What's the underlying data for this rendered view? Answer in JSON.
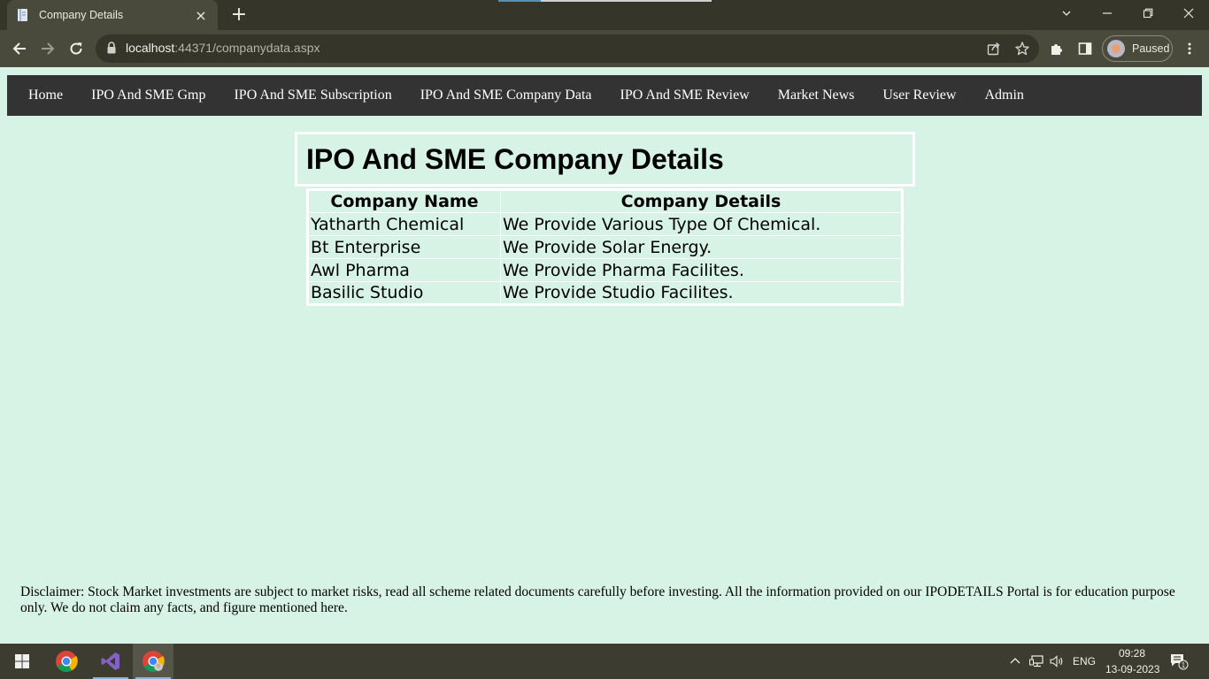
{
  "browser": {
    "tab_title": "Company Details",
    "tab_close_icon": "×",
    "new_tab_icon": "+",
    "url_host": "localhost",
    "url_rest": ":44371/companydata.aspx",
    "profile_label": "Paused"
  },
  "nav": {
    "items": [
      "Home",
      "IPO And SME Gmp",
      "IPO And SME Subscription",
      "IPO And SME Company Data",
      "IPO And SME Review",
      "Market News",
      "User Review",
      "Admin"
    ]
  },
  "page": {
    "title": "IPO And SME Company Details",
    "table": {
      "headers": [
        "Company Name",
        "Company Details"
      ],
      "rows": [
        [
          "Yatharth Chemical",
          "We Provide Various Type Of Chemical."
        ],
        [
          "Bt Enterprise",
          "We Provide Solar Energy."
        ],
        [
          "Awl Pharma",
          "We Provide Pharma Facilites."
        ],
        [
          "Basilic Studio",
          "We Provide Studio Facilites."
        ]
      ]
    },
    "disclaimer": "Disclaimer: Stock Market investments are subject to market risks, read all scheme related documents carefully before investing. All the information provided on our IPODETAILS Portal is for education purpose only. We do not claim any facts, and figure mentioned here."
  },
  "taskbar": {
    "language": "ENG",
    "time": "09:28",
    "date": "13-09-2023",
    "notification_count": "1"
  },
  "colors": {
    "page_background": "#d6f3e6",
    "nav_background": "#333333",
    "browser_frame": "#35352a",
    "browser_toolbar": "#4a4a3c"
  }
}
